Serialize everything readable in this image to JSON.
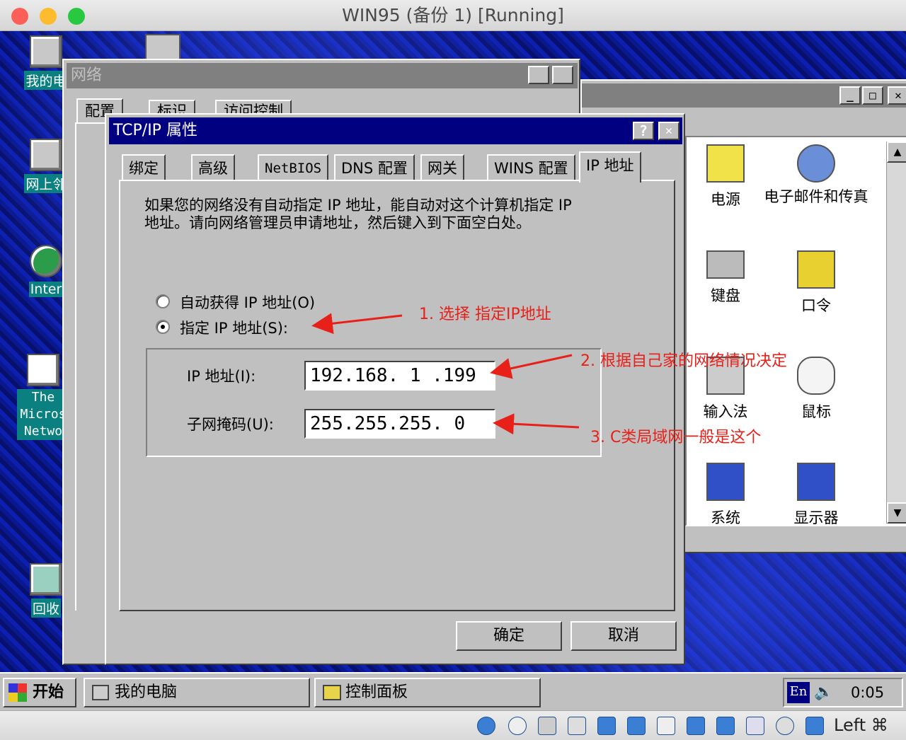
{
  "mac": {
    "title": "WIN95 (备份 1) [Running]"
  },
  "desktop": {
    "icons": [
      {
        "label": "我的电"
      },
      {
        "label": "网上邻"
      },
      {
        "label": "Inter"
      },
      {
        "label": "The Micros Netwo"
      },
      {
        "label": "回收"
      }
    ]
  },
  "network_window": {
    "title": "网络",
    "help_btn": "?",
    "close_btn": "✕",
    "tabs": [
      "配置",
      "标识",
      "访问控制"
    ]
  },
  "control_panel": {
    "items": [
      {
        "label": "电源"
      },
      {
        "label": "电子邮件和传真"
      },
      {
        "label": "键盘"
      },
      {
        "label": "口令"
      },
      {
        "label": "输入法"
      },
      {
        "label": "鼠标"
      },
      {
        "label": "系统"
      },
      {
        "label": "显示器"
      }
    ]
  },
  "tcp_dialog": {
    "title": "TCP/IP 属性",
    "help_btn": "?",
    "close_btn": "✕",
    "tabs": [
      "绑定",
      "高级",
      "NetBIOS",
      "DNS 配置",
      "网关",
      "WINS 配置",
      "IP 地址"
    ],
    "active_tab": "IP 地址",
    "description": "如果您的网络没有自动指定 IP 地址，能自动对这个计算机指定 IP 地址。请向网络管理员申请地址，然后键入到下面空白处。",
    "radio_auto": "自动获得 IP 地址(O)",
    "radio_manual": "指定 IP 地址(S):",
    "ip_label": "IP 地址(I):",
    "ip_value": "192.168. 1 .199",
    "mask_label": "子网掩码(U):",
    "mask_value": "255.255.255. 0",
    "ok": "确定",
    "cancel": "取消"
  },
  "annotations": {
    "a1": "1. 选择 指定IP地址",
    "a2": "2. 根据自己家的网络情况决定",
    "a3": "3. C类局域网一般是这个"
  },
  "taskbar": {
    "start": "开始",
    "tasks": [
      "我的电脑",
      "控制面板"
    ],
    "tray_lang": "En",
    "clock": "0:05"
  },
  "vbox": {
    "host_key": "Left ⌘"
  },
  "colors": {
    "titlebar_active": "#000080",
    "titlebar_inactive": "#808080",
    "annotation": "#e8201a",
    "face": "#c0c0c0"
  }
}
